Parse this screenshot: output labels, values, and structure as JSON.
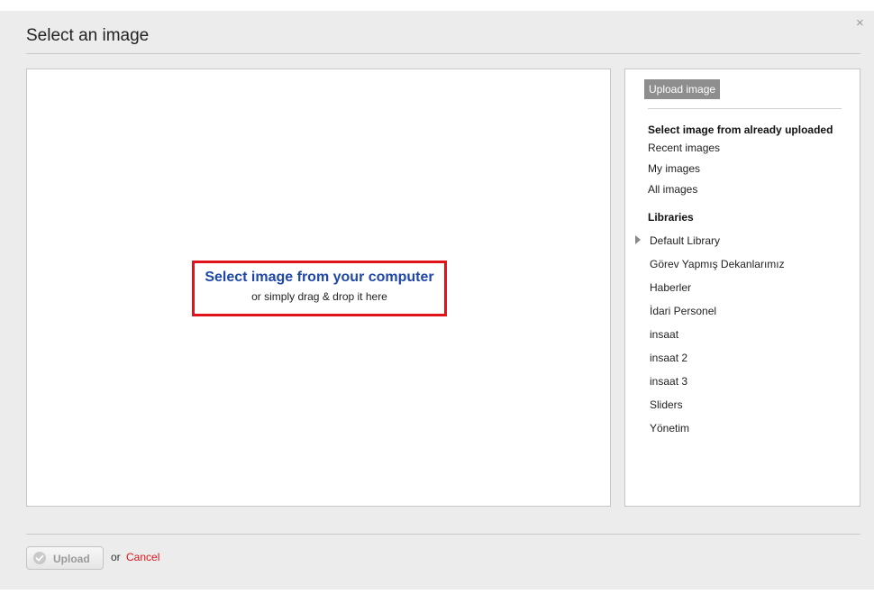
{
  "dialog": {
    "title": "Select an image",
    "close_symbol": "×"
  },
  "drop_zone": {
    "main_label": "Select image from your computer",
    "sub_label": "or simply drag & drop it here"
  },
  "side_panel": {
    "upload_image_label": "Upload image",
    "already_uploaded_heading": "Select image from already uploaded",
    "links": [
      "Recent images",
      "My images",
      "All images"
    ],
    "libraries_heading": "Libraries",
    "libraries": [
      "Default Library",
      "Görev Yapmış Dekanlarımız",
      "Haberler",
      "İdari Personel",
      "insaat",
      "insaat 2",
      "insaat 3",
      "Sliders",
      "Yönetim"
    ]
  },
  "footer": {
    "upload_label": "Upload",
    "or_text": "or",
    "cancel_label": "Cancel"
  },
  "colors": {
    "accent_blue": "#1f47a8",
    "highlight_red": "#e0121a",
    "dialog_bg": "#ececec"
  }
}
